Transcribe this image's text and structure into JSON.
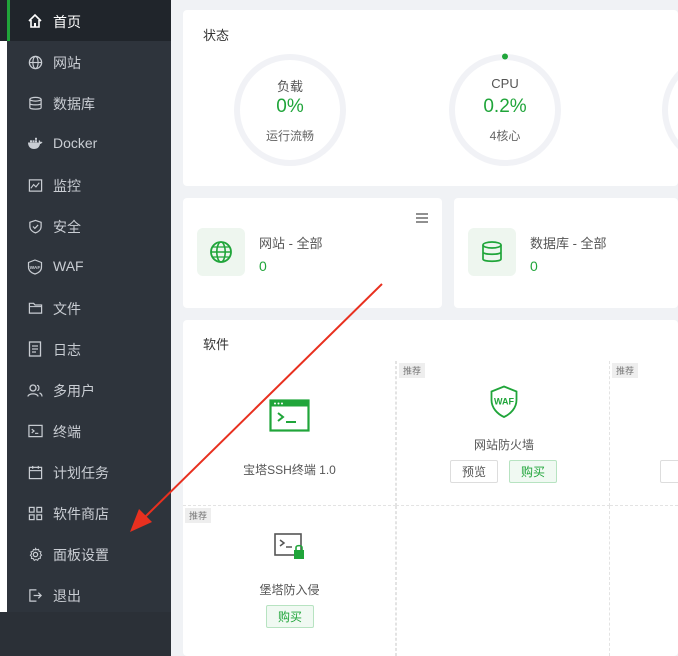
{
  "sidebar": {
    "items": [
      {
        "label": "首页",
        "icon": "home-icon",
        "active": true
      },
      {
        "label": "网站",
        "icon": "globe-icon"
      },
      {
        "label": "数据库",
        "icon": "database-icon"
      },
      {
        "label": "Docker",
        "icon": "docker-icon"
      },
      {
        "label": "监控",
        "icon": "monitor-icon"
      },
      {
        "label": "安全",
        "icon": "shield-icon"
      },
      {
        "label": "WAF",
        "icon": "waf-icon"
      },
      {
        "label": "文件",
        "icon": "folder-icon"
      },
      {
        "label": "日志",
        "icon": "log-icon"
      },
      {
        "label": "多用户",
        "icon": "users-icon"
      },
      {
        "label": "终端",
        "icon": "terminal-icon"
      },
      {
        "label": "计划任务",
        "icon": "calendar-icon"
      },
      {
        "label": "软件商店",
        "icon": "grid-icon"
      },
      {
        "label": "面板设置",
        "icon": "gear-icon"
      },
      {
        "label": "退出",
        "icon": "logout-icon"
      }
    ]
  },
  "status": {
    "title": "状态",
    "load": {
      "label": "负载",
      "value": "0%",
      "sub": "运行流畅"
    },
    "cpu": {
      "label": "CPU",
      "value": "0.2%",
      "sub": "4核心"
    }
  },
  "stats": {
    "website": {
      "title": "网站 - 全部",
      "value": "0"
    },
    "database": {
      "title": "数据库 - 全部",
      "value": "0"
    }
  },
  "software": {
    "title": "软件",
    "items": [
      {
        "name": "宝塔SSH终端 1.0",
        "icon": "terminal-window-icon"
      },
      {
        "name": "网站防火墙",
        "icon": "waf-shield-icon",
        "tag": "推荐",
        "preview": "预览",
        "buy": "购买"
      },
      {
        "tag": "推荐"
      },
      {
        "name": "堡塔防入侵",
        "icon": "terminal-lock-icon",
        "tag": "推荐",
        "buy": "购买"
      }
    ],
    "waf_badge": "WAF"
  },
  "colors": {
    "accent": "#20a53a",
    "sidebar": "#2e343c",
    "arrow": "#e8301f"
  }
}
